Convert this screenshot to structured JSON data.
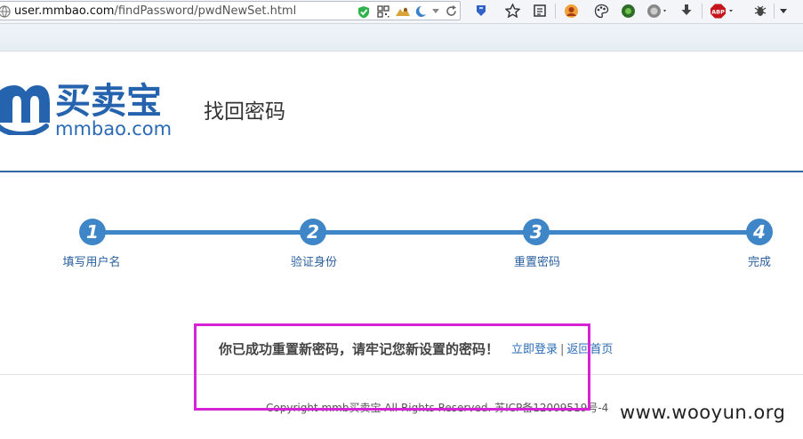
{
  "browser": {
    "url_host": "user.mmbao.com",
    "url_path": "/findPassword/pwdNewSet.html",
    "toolbar_icons": [
      "shield-icon",
      "qr-code-icon",
      "extension-icon",
      "moon-icon",
      "dropdown-arrow-icon",
      "reload-icon",
      "pocket-icon",
      "star-icon",
      "reading-list-icon",
      "firefox-account-icon",
      "palette-icon",
      "green-ball-icon",
      "globe-icon",
      "download-icon",
      "adblock-icon",
      "bug-icon",
      "menu-icon"
    ],
    "adblock_label": "ABP"
  },
  "header": {
    "logo_cn": "买卖宝",
    "logo_en": "mmbao.com",
    "title": "找回密码"
  },
  "steps": [
    {
      "number": "1",
      "label": "填写用户名"
    },
    {
      "number": "2",
      "label": "验证身份"
    },
    {
      "number": "3",
      "label": "重置密码"
    },
    {
      "number": "4",
      "label": "完成"
    }
  ],
  "result": {
    "message": "你已成功重置新密码，请牢记您新设置的密码！",
    "login_link": "立即登录",
    "separator": "|",
    "home_link": "返回首页"
  },
  "footer": {
    "copyright": "Copyright mmb买卖宝  All Rights Reserved. 苏ICP备12009519号-4"
  },
  "watermark": "www.wooyun.org",
  "colors": {
    "brand_blue": "#2563ae",
    "step_blue": "#3e86c7",
    "highlight_magenta": "#d623d6"
  }
}
